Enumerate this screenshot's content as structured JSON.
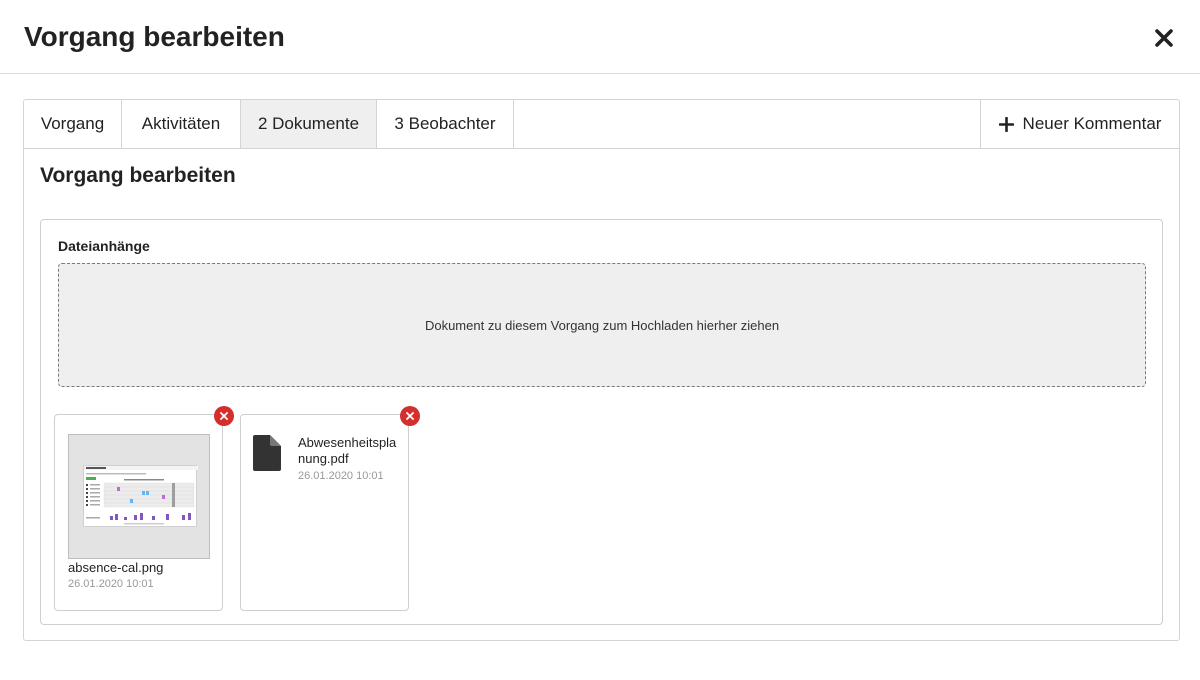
{
  "modal": {
    "title": "Vorgang bearbeiten",
    "close_icon": "close-icon"
  },
  "tabs": [
    {
      "label": "Vorgang",
      "active": false
    },
    {
      "label": "Aktivitäten",
      "active": false
    },
    {
      "label": "2 Dokumente",
      "active": true
    },
    {
      "label": "3 Beobachter",
      "active": false
    }
  ],
  "new_comment": {
    "label": "Neuer Kommentar",
    "icon": "plus-icon"
  },
  "section": {
    "title": "Vorgang bearbeiten"
  },
  "attachments": {
    "label": "Dateianhänge",
    "dropzone_text": "Dokument zu diesem Vorgang zum Hochladen hierher ziehen",
    "files": [
      {
        "name": "absence-cal.png",
        "date": "26.01.2020 10:01",
        "type": "image",
        "icon": "image-thumbnail"
      },
      {
        "name": "Abwesenheitsplanung.pdf",
        "date": "26.01.2020 10:01",
        "type": "pdf",
        "icon": "document-icon"
      }
    ],
    "remove_color": "#d32f2f"
  },
  "colors": {
    "active_tab": "#efefef",
    "border": "#d4d4d4",
    "dropzone_bg": "#efefef",
    "muted_text": "#999999"
  }
}
